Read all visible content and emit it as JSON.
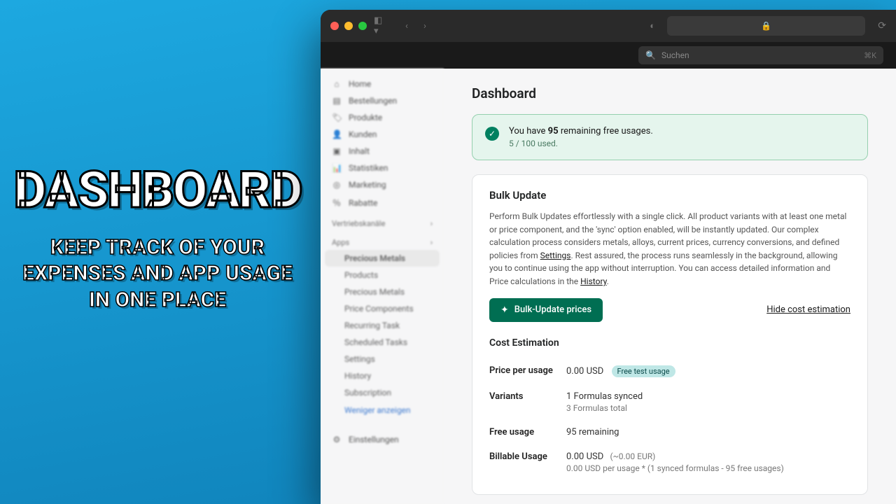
{
  "promo": {
    "title": "DASHBOARD",
    "subtitle": "KEEP TRACK OF YOUR EXPENSES AND APP USAGE IN ONE PLACE"
  },
  "browser": {
    "lock": "🔒",
    "reload": "⟳"
  },
  "search": {
    "placeholder": "Suchen",
    "shortcut": "⌘K"
  },
  "sidebar": {
    "primary": [
      {
        "icon": "⌂",
        "label": "Home"
      },
      {
        "icon": "▤",
        "label": "Bestellungen"
      },
      {
        "icon": "🏷",
        "label": "Produkte"
      },
      {
        "icon": "👤",
        "label": "Kunden"
      },
      {
        "icon": "▣",
        "label": "Inhalt"
      },
      {
        "icon": "📊",
        "label": "Statistiken"
      },
      {
        "icon": "◎",
        "label": "Marketing"
      },
      {
        "icon": "％",
        "label": "Rabatte"
      }
    ],
    "section_channels": "Vertriebskanäle",
    "section_apps": "Apps",
    "app_items": [
      "Precious Metals",
      "Products",
      "Precious Metals",
      "Price Components",
      "Recurring Task",
      "Scheduled Tasks",
      "Settings",
      "History",
      "Subscription"
    ],
    "less": "Weniger anzeigen",
    "bottom": {
      "icon": "⚙",
      "label": "Einstellungen"
    }
  },
  "page": {
    "title": "Dashboard"
  },
  "banner": {
    "text_pre": "You have ",
    "strong": "95",
    "text_post": " remaining free usages.",
    "sub": "5 / 100 used."
  },
  "bulk": {
    "heading": "Bulk Update",
    "desc_a": "Perform Bulk Updates effortlessly with a single click. All product variants with at least one metal or price component, and the 'sync' option enabled, will be instantly updated. Our complex calculation process considers metals, alloys, current prices, currency conversions, and defined policies from ",
    "link_settings": "Settings",
    "desc_b": ". Rest assured, the process runs seamlessly in the background, allowing you to continue using the app without interruption. You can access detailed information and Price calculations in the ",
    "link_history": "History",
    "desc_c": ".",
    "btn": "Bulk-Update prices",
    "hide": "Hide cost estimation"
  },
  "cost": {
    "heading": "Cost Estimation",
    "rows": {
      "price": {
        "label": "Price per usage",
        "value": "0.00 USD",
        "badge": "Free test usage"
      },
      "variants": {
        "label": "Variants",
        "value": "1 Formulas synced",
        "meta": "3 Formulas total"
      },
      "free": {
        "label": "Free usage",
        "value": "95 remaining"
      },
      "billable": {
        "label": "Billable Usage",
        "value": "0.00 USD",
        "meta_paren": "(~0.00 EUR)",
        "meta": "0.00 USD per usage * (1 synced formulas - 95 free usages)"
      }
    }
  }
}
